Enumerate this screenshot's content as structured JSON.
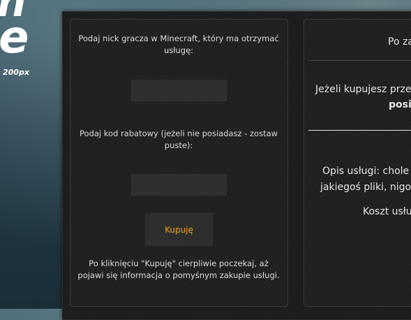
{
  "logo": {
    "line1": "n",
    "line2": "e",
    "size_text": "200px"
  },
  "form": {
    "nick_label": "Podaj nick gracza w Minecraft, który ma otrzymać usługę:",
    "nick_value": "",
    "code_label": "Podaj kod rabatowy (jeżeli nie posiadasz - zostaw puste):",
    "code_value": "",
    "buy_button": "Kupuję",
    "info": "Po kliknięciu \"Kupuję\" cierpliwie poczekaj, aż pojawi się informacja o pomyśnym zakupie usługi."
  },
  "details": {
    "title_partial": "Po za",
    "purchase_line1": "Jeżeli kupujesz prze",
    "purchase_line2": "posi",
    "desc_line1": "Opis usługi: chole",
    "desc_line2": "jakiegoś pliki, nigo",
    "cost_partial": "Koszt usłu"
  },
  "colors": {
    "accent": "#e8a21c",
    "panel": "#1c1c1c",
    "input": "#2f2f2f"
  }
}
